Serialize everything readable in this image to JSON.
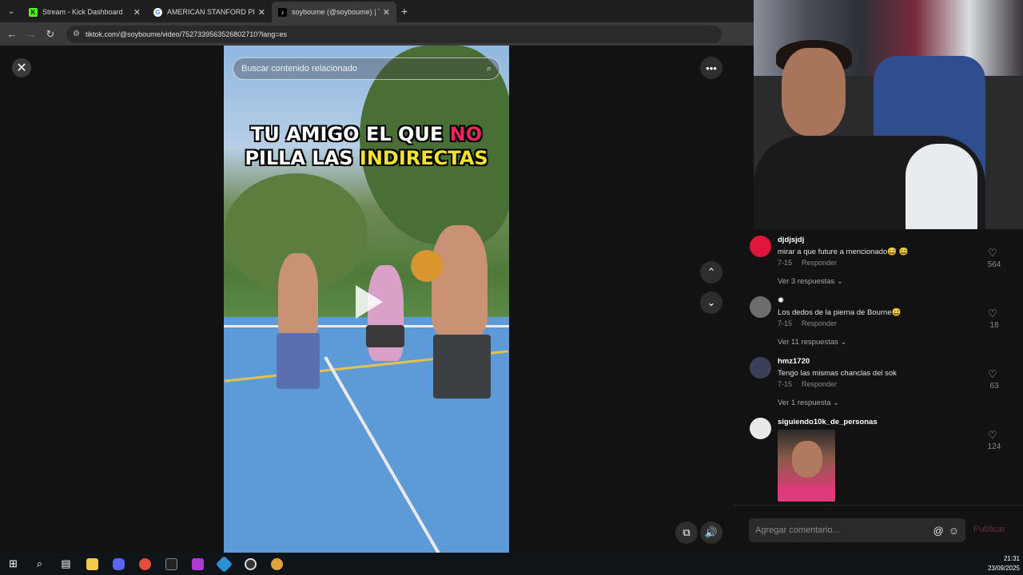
{
  "browser": {
    "tabs": [
      {
        "title": "Stream - Kick Dashboard",
        "favicon": "K",
        "favicon_color": "#53fc18",
        "active": false
      },
      {
        "title": "AMERICAN STANFORD PITBUL",
        "favicon": "G",
        "favicon_color": "#4285f4",
        "active": false
      },
      {
        "title": "soyboume (@soyboume) | TikT",
        "favicon": "♪",
        "favicon_color": "#000000",
        "active": true
      }
    ],
    "url": "tiktok.com/@soyboume/video/7527339563526802710?lang=es"
  },
  "video": {
    "search_placeholder": "Buscar contenido relacionado",
    "caption_line1_a": "TU AMIGO EL QUE ",
    "caption_line1_b": "NO",
    "caption_line2_a": "PILLA LAS ",
    "caption_line2_b": "INDIRECTAS"
  },
  "comments": [
    {
      "user": "djdjsjdj",
      "text": "mirar a que future a mencionado😅 😅",
      "date": "7-15",
      "reply": "Responder",
      "more": "Ver 3 respuestas ⌄",
      "likes": "564",
      "avatar_color": "#e0163d"
    },
    {
      "user": "✵",
      "text": "Los dedos de la pierna de Bourne😅",
      "date": "7-15",
      "reply": "Responder",
      "more": "Ver 11 respuestas ⌄",
      "likes": "18",
      "avatar_color": "#6d6d6d"
    },
    {
      "user": "hmz1720",
      "text": "Tengo las mismas chanclas del sok",
      "date": "7-15",
      "reply": "Responder",
      "more": "Ver 1 respuesta ⌄",
      "likes": "63",
      "avatar_color": "#3a3f5a"
    },
    {
      "user": "siguiendo10k_de_personas",
      "text": "",
      "date": "",
      "reply": "",
      "more": "",
      "likes": "124",
      "avatar_color": "#e9e9e9"
    }
  ],
  "comment_input": {
    "placeholder": "Agregar comentario...",
    "publish": "Publicar"
  },
  "taskbar": {
    "time": "21:31",
    "date": "23/09/2025"
  }
}
